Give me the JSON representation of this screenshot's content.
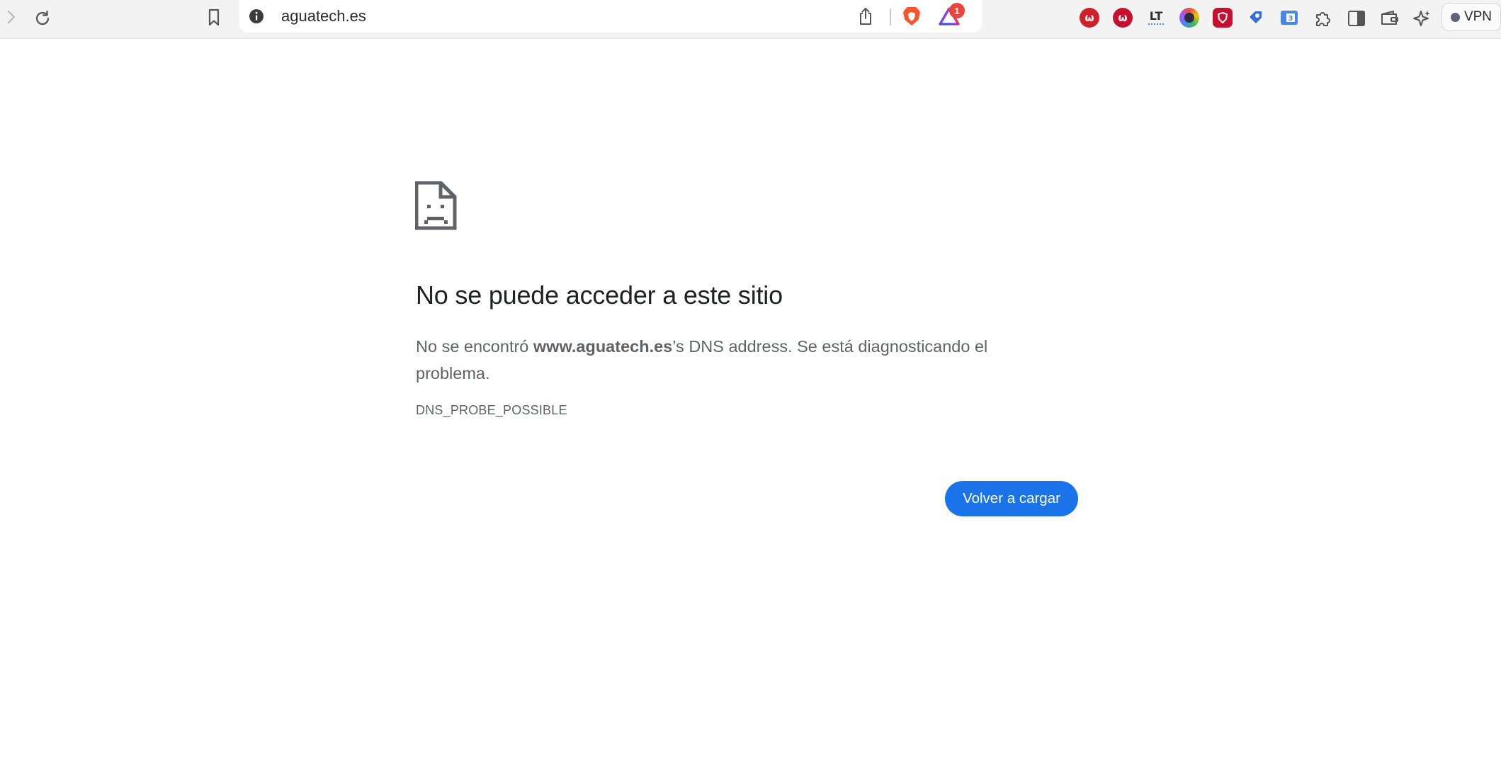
{
  "browser": {
    "url": "aguatech.es",
    "rewards_badge_count": "1",
    "vpn_label": "VPN",
    "icons": [
      "forward-icon",
      "reload-icon",
      "bookmark-icon",
      "site-info-icon",
      "share-icon",
      "brave-shields-icon",
      "brave-rewards-icon"
    ],
    "extensions": [
      {
        "name": "extension-w-red-1",
        "glyph": "ω",
        "color": "#d0202a"
      },
      {
        "name": "extension-w-red-2",
        "glyph": "ω",
        "color": "#c8102e"
      },
      {
        "name": "extension-languagetool",
        "glyph": "LT",
        "color": "#2d2d2d"
      },
      {
        "name": "extension-color-circle",
        "glyph": "",
        "color": "#3b3b3b"
      },
      {
        "name": "extension-shield-red",
        "glyph": "",
        "color": "#c8102e"
      },
      {
        "name": "extension-tag-blue",
        "glyph": "",
        "color": "#2f6fd6"
      },
      {
        "name": "extension-reader-blue",
        "glyph": "",
        "color": "#4a86e8"
      }
    ]
  },
  "error": {
    "title": "No se puede acceder a este sitio",
    "desc_prefix": "No se encontró ",
    "desc_host": "www.aguatech.es",
    "desc_suffix": "’s DNS address. Se está diagnosticando el problema.",
    "code": "DNS_PROBE_POSSIBLE",
    "reload_label": "Volver a cargar"
  }
}
